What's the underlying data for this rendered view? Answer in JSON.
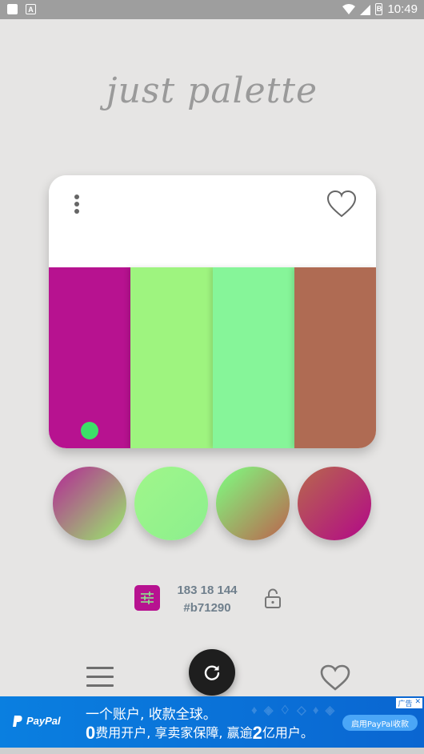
{
  "status_bar": {
    "time": "10:49",
    "battery_label": "B"
  },
  "app": {
    "title": "just palette"
  },
  "palette": {
    "swatches": [
      "#b71290",
      "#9ef47f",
      "#86f599",
      "#af6b53"
    ],
    "selected_index": 0,
    "selected_dot_color": "#3ce068"
  },
  "gradients": [
    {
      "from": "#b0448f",
      "to": "#9dce72"
    },
    {
      "from": "#9df58b",
      "to": "#8ff08d"
    },
    {
      "from": "#86e97a",
      "to": "#b37a55"
    },
    {
      "from": "#b75a55",
      "to": "#b3167f"
    }
  ],
  "color_info": {
    "rgb": "183 18 144",
    "hex": "#b71290",
    "swatch_color": "#b71290"
  },
  "icons": {
    "card_menu": "more-vertical-icon",
    "card_favorite": "heart-outline-icon",
    "adjust": "sliders-icon",
    "lock": "lock-open-icon",
    "nav_menu": "hamburger-icon",
    "refresh": "refresh-icon",
    "nav_favorite": "heart-outline-icon"
  },
  "ad": {
    "brand": "PayPal",
    "line1": "一个账户, 收款全球。",
    "line2_num1": "0",
    "line2_mid": "费用开户, 享卖家保障, 赢逾",
    "line2_num2": "2",
    "line2_end": "亿用户。",
    "cta": "启用PayPal收款",
    "tag": "广告"
  }
}
